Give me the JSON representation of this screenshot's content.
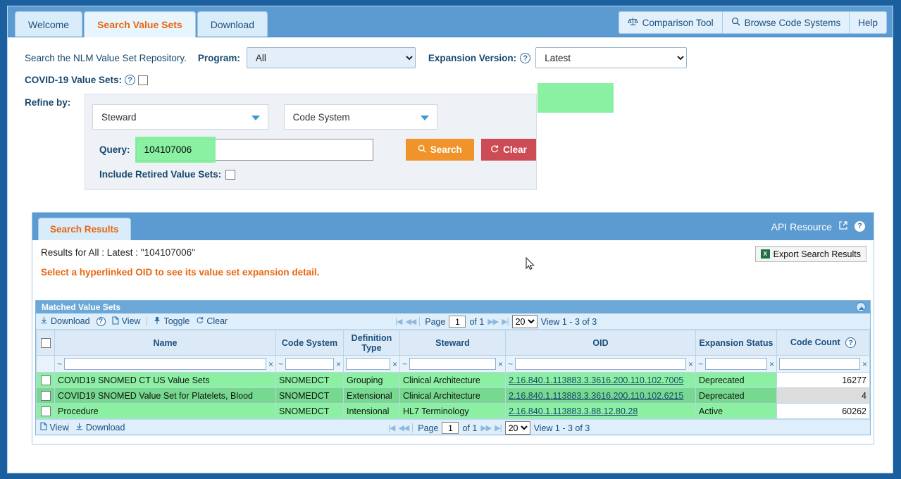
{
  "tabs": [
    {
      "label": "Welcome",
      "active": false
    },
    {
      "label": "Search Value Sets",
      "active": true
    },
    {
      "label": "Download",
      "active": false
    }
  ],
  "top_right_buttons": [
    {
      "label": "Comparison Tool",
      "icon": "scales-icon"
    },
    {
      "label": "Browse Code Systems",
      "icon": "search-icon"
    },
    {
      "label": "Help",
      "icon": ""
    }
  ],
  "search": {
    "intro": "Search the NLM Value Set Repository.",
    "program_label": "Program:",
    "program_value": "All",
    "program_options": [
      "All"
    ],
    "expansion_label": "Expansion Version:",
    "expansion_value": "Latest",
    "expansion_options": [
      "Latest"
    ],
    "covid_label": "COVID-19 Value Sets:",
    "refine_label": "Refine by:",
    "steward_value": "Steward",
    "codesystem_value": "Code System",
    "query_label": "Query:",
    "query_value": "104107006",
    "search_button": "Search",
    "clear_button": "Clear",
    "include_retired_label": "Include Retired Value Sets:"
  },
  "results": {
    "tab_label": "Search Results",
    "api_resource": "API Resource",
    "results_for": "Results for All : Latest : \"104107006\"",
    "hint": "Select a hyperlinked OID to see its value set expansion detail.",
    "export_label": "Export Search Results"
  },
  "grid": {
    "title": "Matched Value Sets",
    "toolbar": [
      {
        "label": "Download",
        "icon": "download-icon"
      },
      {
        "label": "View",
        "icon": "document-icon"
      },
      {
        "label": "Toggle",
        "icon": "pin-icon"
      },
      {
        "label": "Clear",
        "icon": "refresh-icon"
      }
    ],
    "footer_toolbar": [
      {
        "label": "View",
        "icon": "document-icon"
      },
      {
        "label": "Download",
        "icon": "download-icon"
      }
    ],
    "pager": {
      "page_label": "Page",
      "page_value": "1",
      "of_label": "of 1",
      "page_size": "20",
      "page_size_options": [
        "20"
      ],
      "view_label": "View 1 - 3 of 3"
    },
    "columns": [
      {
        "key": "check",
        "label": "",
        "filter": false
      },
      {
        "key": "name",
        "label": "Name",
        "filter": true,
        "tilde": true
      },
      {
        "key": "code_system",
        "label": "Code System",
        "filter": true,
        "tilde": true
      },
      {
        "key": "definition_type",
        "label": "Definition Type",
        "filter": true,
        "tilde": false
      },
      {
        "key": "steward",
        "label": "Steward",
        "filter": true,
        "tilde": true
      },
      {
        "key": "oid",
        "label": "OID",
        "filter": true,
        "tilde": true
      },
      {
        "key": "expansion_status",
        "label": "Expansion Status",
        "filter": true,
        "tilde": true
      },
      {
        "key": "code_count",
        "label": "Code Count",
        "filter": true,
        "tilde": false,
        "help": true
      }
    ],
    "rows": [
      {
        "name": "COVID19 SNOMED CT US Value Sets",
        "code_system": "SNOMEDCT",
        "definition_type": "Grouping",
        "steward": "Clinical Architecture",
        "oid": "2.16.840.1.113883.3.3616.200.110.102.7005",
        "expansion_status": "Deprecated",
        "code_count": "16277"
      },
      {
        "name": "COVID19 SNOMED Value Set for Platelets, Blood",
        "code_system": "SNOMEDCT",
        "definition_type": "Extensional",
        "steward": "Clinical Architecture",
        "oid": "2.16.840.1.113883.3.3616.200.110.102.6215",
        "expansion_status": "Deprecated",
        "code_count": "4"
      },
      {
        "name": "Procedure",
        "code_system": "SNOMEDCT",
        "definition_type": "Intensional",
        "steward": "HL7 Terminology",
        "oid": "2.16.840.1.113883.3.88.12.80.28",
        "expansion_status": "Active",
        "code_count": "60262"
      }
    ]
  },
  "colors": {
    "highlight_green": "#80f09a",
    "accent_orange": "#e8660f",
    "header_blue": "#5b9bd1",
    "search_button": "#f0932b",
    "clear_button": "#cc4b55",
    "page_background": "#1c5f9e"
  }
}
